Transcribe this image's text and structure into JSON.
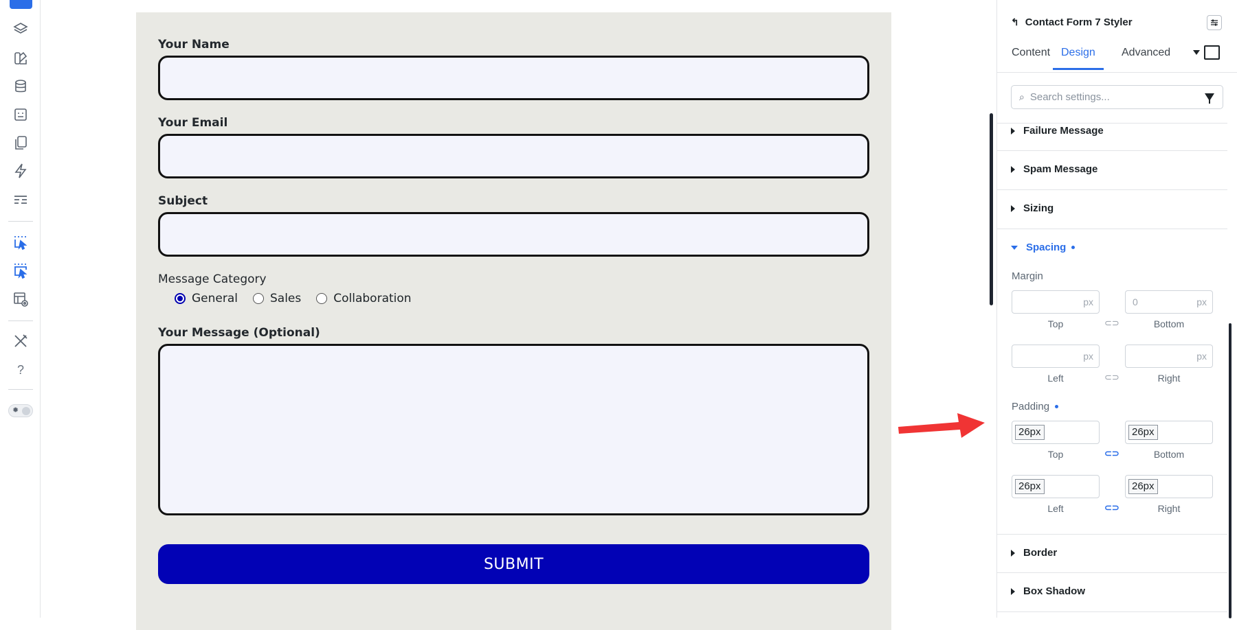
{
  "rail": {
    "icons": [
      "layers-icon",
      "palette-icon",
      "database-icon",
      "form-icon",
      "pages-icon",
      "lightning-icon",
      "sections-icon",
      "dynamic-select-icon",
      "multi-select-icon",
      "template-view-icon",
      "tools-icon",
      "help-icon"
    ],
    "help_glyph": "?"
  },
  "form": {
    "name_label": "Your Name",
    "email_label": "Your Email",
    "subject_label": "Subject",
    "category_label": "Message Category",
    "options": [
      "General",
      "Sales",
      "Collaboration"
    ],
    "selected_option": "General",
    "message_label": "Your Message (Optional)",
    "submit_label": "SUBMIT"
  },
  "panel": {
    "title": "Contact Form 7 Styler",
    "back_glyph": "↰",
    "tabs": [
      "Content",
      "Design",
      "Advanced"
    ],
    "active_tab": "Design",
    "search_placeholder": "Search settings...",
    "search_glyph": "⌕",
    "sections_above": [
      "Failure Message",
      "Spam Message",
      "Sizing"
    ],
    "open_section": "Spacing",
    "margin": {
      "label": "Margin",
      "top": {
        "value": "",
        "unit": "px",
        "caption": "Top"
      },
      "bottom": {
        "value": "0",
        "unit": "px",
        "caption": "Bottom"
      },
      "left": {
        "value": "",
        "unit": "px",
        "caption": "Left"
      },
      "right": {
        "value": "",
        "unit": "px",
        "caption": "Right"
      },
      "linked": false
    },
    "padding": {
      "label": "Padding",
      "top": {
        "value": "26px",
        "caption": "Top"
      },
      "bottom": {
        "value": "26px",
        "caption": "Bottom"
      },
      "left": {
        "value": "26px",
        "caption": "Left"
      },
      "right": {
        "value": "26px",
        "caption": "Right"
      },
      "linked": true
    },
    "link_glyph_off": "⊂⊃",
    "link_glyph_on": "⊂⊃",
    "sections_below": [
      "Border",
      "Box Shadow"
    ]
  },
  "colors": {
    "accent": "#2b6ee8",
    "submit_bg": "#0202b5",
    "form_bg": "#e9e9e4",
    "field_bg": "#f3f4fc",
    "annotation_arrow": "#f03434"
  }
}
